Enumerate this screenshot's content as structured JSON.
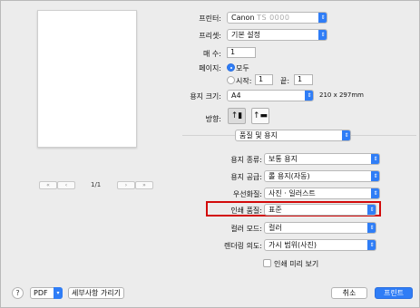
{
  "printer": {
    "label": "프린터:",
    "name": "Canon",
    "model_blurred": "TS 0000"
  },
  "presets": {
    "label": "프리셋:",
    "value": "기본 설정"
  },
  "copies": {
    "label": "매 수:",
    "value": "1"
  },
  "pages": {
    "label": "페이지:",
    "all_label": "모두",
    "from_label": "시작:",
    "from_value": "1",
    "to_label": "끝:",
    "to_value": "1"
  },
  "paper_size": {
    "label": "용지 크기:",
    "value": "A4",
    "dimensions": "210 x 297mm"
  },
  "orientation": {
    "label": "방향:",
    "portrait_glyph": "↑▮",
    "landscape_glyph": "↑▬"
  },
  "section_popup": {
    "value": "품질 및 용지"
  },
  "media_type": {
    "label": "용지 종류:",
    "value": "보통 용지"
  },
  "paper_source": {
    "label": "용지 공급:",
    "value": "롤 용지(자동)"
  },
  "priority": {
    "label": "우선화질:",
    "value": "사진 · 일러스트"
  },
  "print_quality": {
    "label": "인쇄 품질:",
    "value": "표준"
  },
  "color_mode": {
    "label": "컬러 모드:",
    "value": "컬러"
  },
  "rendering_intent": {
    "label": "렌더링 의도:",
    "value": "가시 범위(사진)"
  },
  "print_preview": {
    "label": "인쇄 미리 보기"
  },
  "preview_nav": {
    "first": "«",
    "prev": "‹",
    "next": "›",
    "last": "»",
    "page_count": "1/1"
  },
  "footer": {
    "help": "?",
    "pdf_label": "PDF",
    "hide_details": "세부사항 가리기",
    "cancel": "취소",
    "print": "프린트"
  },
  "colors": {
    "accent": "#2f7df6",
    "highlight": "#d20a0a"
  },
  "icons": {
    "popup": "chevron-updown-icon",
    "dropdown": "chevron-down-icon"
  }
}
